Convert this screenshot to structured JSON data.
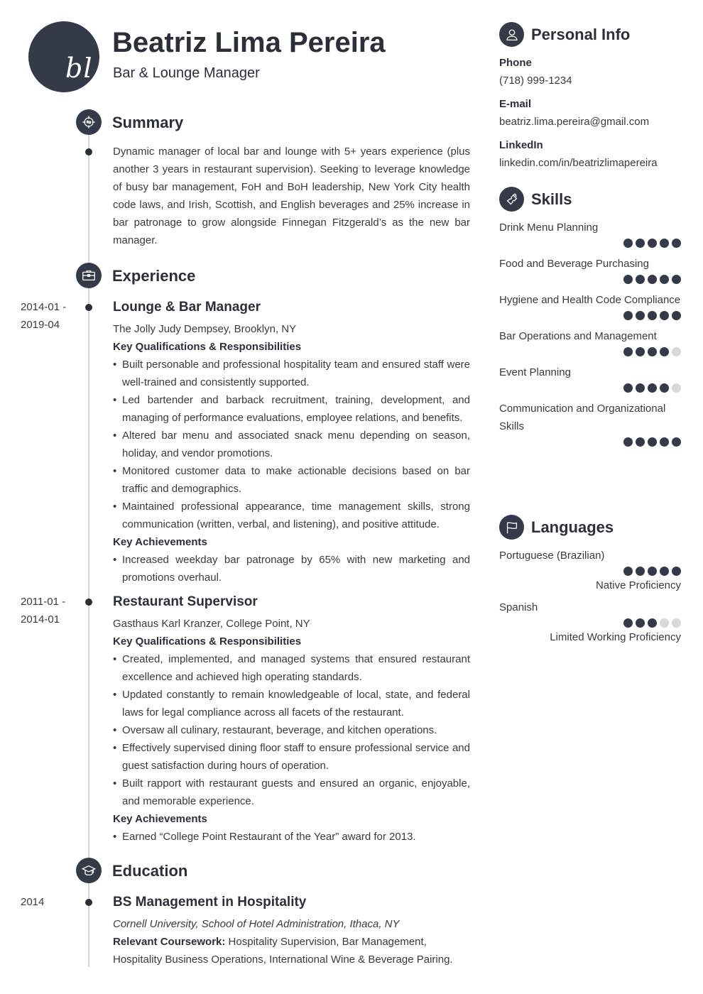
{
  "header": {
    "initials": "bl",
    "name": "Beatriz Lima Pereira",
    "title": "Bar & Lounge Manager"
  },
  "summary": {
    "heading": "Summary",
    "icon": "target-icon",
    "text": "Dynamic manager of local bar and lounge with 5+ years experience (plus another 3 years in restaurant supervision). Seeking to leverage knowledge of busy bar management, FoH and BoH leadership, New York City health code laws, and Irish, Scottish, and English beverages and 25% increase in bar patronage to grow alongside Finnegan Fitzgerald’s as the new bar manager."
  },
  "experience": {
    "heading": "Experience",
    "icon": "briefcase-icon",
    "jobs": [
      {
        "date_start": "2014-01 -",
        "date_end": "2019-04",
        "role": "Lounge & Bar Manager",
        "company": "The Jolly Judy Dempsey, Brooklyn, NY",
        "qual_heading": "Key Qualifications & Responsibilities",
        "responsibilities": [
          "Built personable and professional hospitality team and ensured staff were well-trained and consistently supported.",
          "Led bartender and barback recruitment, training, development, and managing of performance evaluations, employee relations, and benefits.",
          "Altered bar menu and associated snack menu depending on season, holiday, and vendor promotions.",
          "Monitored customer data to make actionable decisions based on bar traffic and demographics.",
          "Maintained professional appearance, time management skills, strong communication (written, verbal, and listening), and positive attitude."
        ],
        "ach_heading": "Key Achievements",
        "achievements": [
          "Increased weekday bar patronage by 65% with new marketing and promotions overhaul."
        ]
      },
      {
        "date_start": "2011-01 -",
        "date_end": "2014-01",
        "role": "Restaurant Supervisor",
        "company": "Gasthaus Karl Kranzer, College Point, NY",
        "qual_heading": "Key Qualifications & Responsibilities",
        "responsibilities": [
          "Created, implemented, and managed systems that ensured restaurant excellence and achieved high operating standards.",
          "Updated constantly to remain knowledgeable of local, state, and federal laws for legal compliance across all facets of the restaurant.",
          "Oversaw all culinary, restaurant, beverage, and kitchen operations.",
          "Effectively supervised dining floor staff to ensure professional service and guest satisfaction during hours of operation.",
          "Built rapport with restaurant guests and ensured an organic, enjoyable, and memorable experience."
        ],
        "ach_heading": "Key Achievements",
        "achievements": [
          "Earned “College Point Restaurant of the Year” award for 2013."
        ]
      }
    ]
  },
  "education": {
    "heading": "Education",
    "icon": "graduation-cap-icon",
    "items": [
      {
        "date": "2014",
        "degree": "BS Management in Hospitality",
        "school": "Cornell University, School of Hotel Administration, Ithaca, NY",
        "coursework_label": "Relevant Coursework:",
        "coursework": " Hospitality Supervision, Bar Management, Hospitality Business Operations, International Wine & Beverage Pairing."
      }
    ]
  },
  "personal_info": {
    "heading": "Personal Info",
    "icon": "user-icon",
    "fields": [
      {
        "label": "Phone",
        "value": "(718) 999-1234"
      },
      {
        "label": "E-mail",
        "value": "beatriz.lima.pereira@gmail.com"
      },
      {
        "label": "LinkedIn",
        "value": "linkedin.com/in/beatrizlimapereira"
      }
    ]
  },
  "skills": {
    "heading": "Skills",
    "icon": "puzzle-icon",
    "max_rating": 5,
    "items": [
      {
        "name": "Drink Menu Planning",
        "rating": 5
      },
      {
        "name": "Food and Beverage Purchasing",
        "rating": 5
      },
      {
        "name": "Hygiene and Health Code Compliance",
        "rating": 5
      },
      {
        "name": "Bar Operations and Management",
        "rating": 4
      },
      {
        "name": "Event Planning",
        "rating": 4
      },
      {
        "name": "Communication and Organizational Skills",
        "rating": 5
      }
    ]
  },
  "languages": {
    "heading": "Languages",
    "icon": "flag-icon",
    "max_rating": 5,
    "items": [
      {
        "name": "Portuguese (Brazilian)",
        "rating": 5,
        "level": "Native Proficiency"
      },
      {
        "name": "Spanish",
        "rating": 3,
        "level": "Limited Working Proficiency"
      }
    ]
  },
  "colors": {
    "accent": "#343a48",
    "text": "#3a3a3a",
    "rating_off": "#d8d8d8",
    "timeline": "#d6d6d6"
  }
}
